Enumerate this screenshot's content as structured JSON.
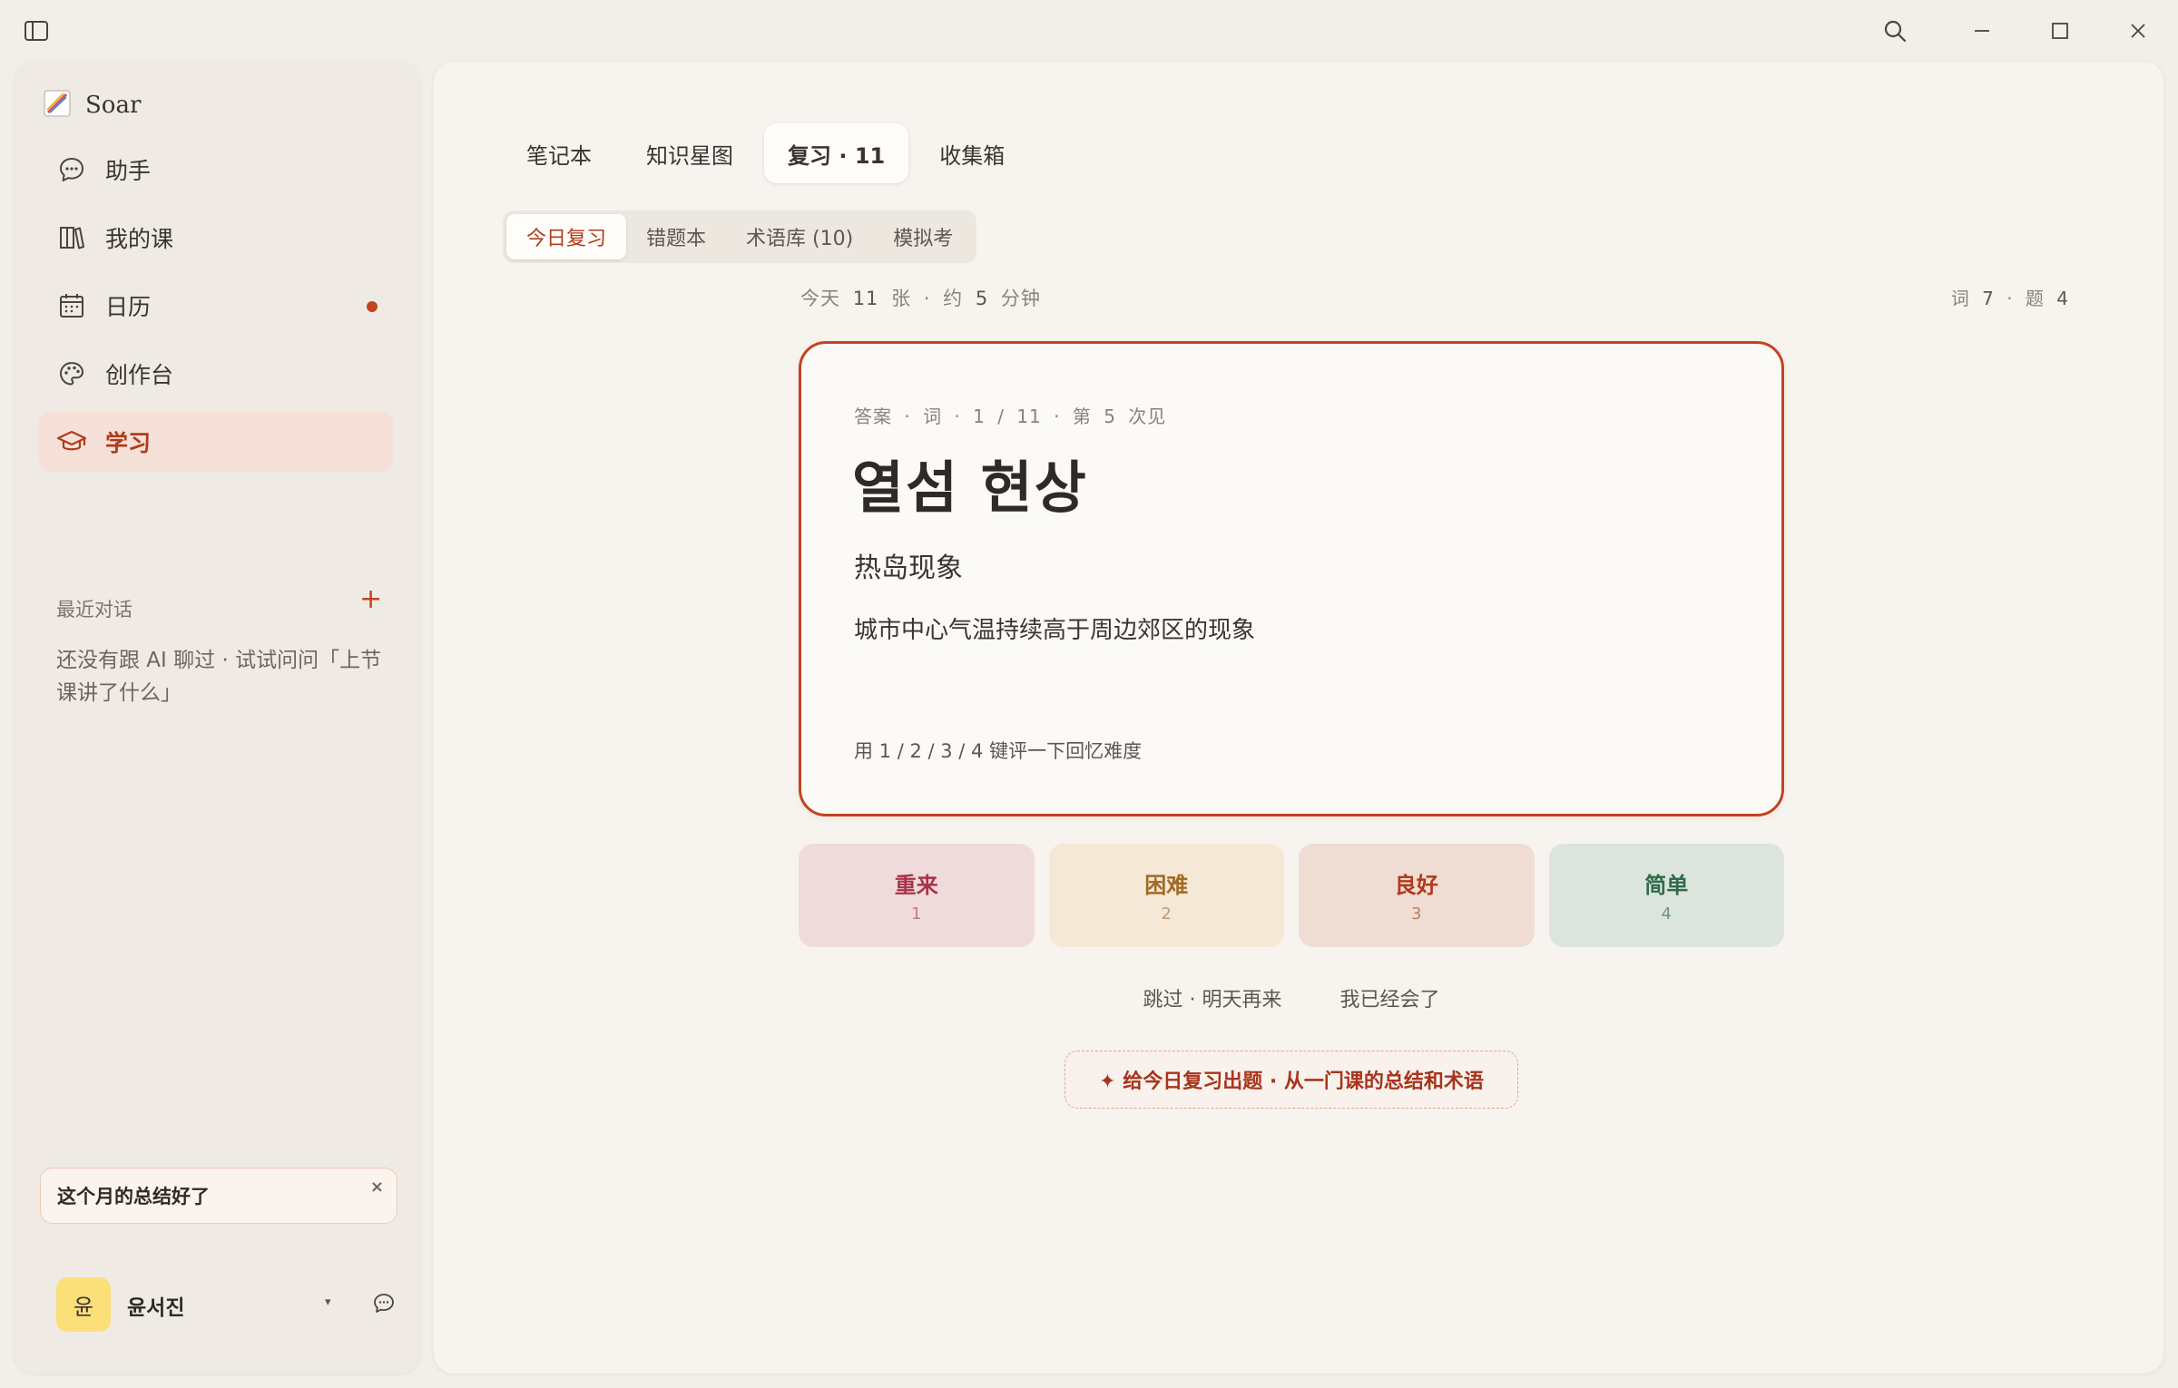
{
  "titlebar": {
    "icons": [
      "sidebar-toggle-icon",
      "search-icon",
      "minimize-icon",
      "maximize-icon",
      "close-icon"
    ]
  },
  "sidebar": {
    "brand": "Soar",
    "items": [
      {
        "label": "助手",
        "icon": "chat-bubble-icon"
      },
      {
        "label": "我的课",
        "icon": "books-icon"
      },
      {
        "label": "日历",
        "icon": "calendar-icon",
        "badge_dot": true
      },
      {
        "label": "创作台",
        "icon": "palette-icon"
      },
      {
        "label": "学习",
        "icon": "graduation-cap-icon",
        "active": true
      }
    ],
    "recent_label": "最近对话",
    "recent_add": "+",
    "recent_empty": "还没有跟 AI 聊过 · 试试问问「上节课讲了什么」",
    "toast": {
      "text": "这个月的总结好了",
      "close": "×"
    },
    "user": {
      "avatar": "윤",
      "name": "윤서진",
      "caret": "▾"
    }
  },
  "main": {
    "tabs": [
      "笔记本",
      "知识星图",
      "复习 · 11",
      "收集箱"
    ],
    "active_tab": 2,
    "subtabs": [
      "今日复习",
      "错题本",
      "术语库 (10)",
      "模拟考"
    ],
    "active_subtab": 0,
    "meta_left": {
      "a": "今天",
      "count": "11",
      "b": "张 · 约",
      "mins": "5",
      "c": "分钟"
    },
    "meta_right": {
      "a": "词",
      "words": "7",
      "b": "· 题",
      "questions": "4"
    },
    "card": {
      "meta": "答案 · 词 · 1 / 11 · 第 5 次见",
      "term": "열섬 현상",
      "translation": "热岛现象",
      "definition": "城市中心气温持续高于周边郊区的现象",
      "hint": "用 1 / 2 / 3 / 4 键评一下回忆难度"
    },
    "grades": [
      {
        "label": "重来",
        "key": "1"
      },
      {
        "label": "困难",
        "key": "2"
      },
      {
        "label": "良好",
        "key": "3"
      },
      {
        "label": "简单",
        "key": "4"
      }
    ],
    "skip": "跳过 · 明天再来",
    "known": "我已经会了",
    "generate": "✦ 给今日复习出题 · 从一门课的总结和术语"
  },
  "colors": {
    "accent": "#c2431f",
    "background": "#f2efe9",
    "panel": "#f7f4ef"
  }
}
